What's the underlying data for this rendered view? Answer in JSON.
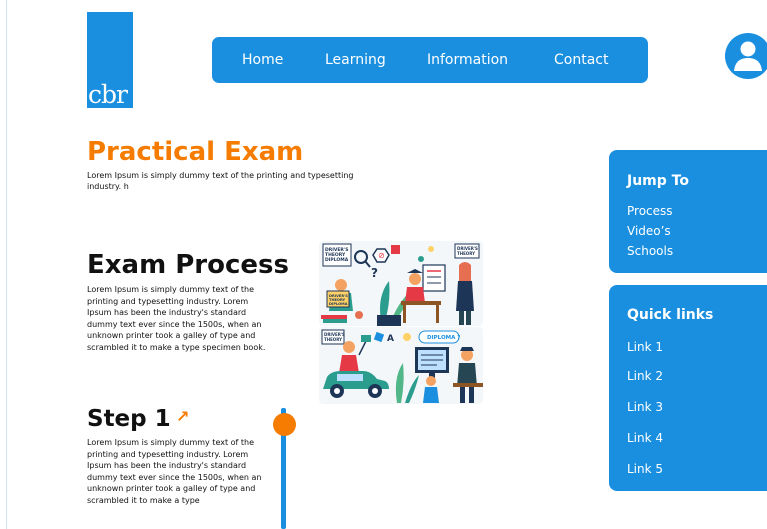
{
  "logo": {
    "text": "cbr"
  },
  "nav": {
    "items": [
      {
        "label": "Home"
      },
      {
        "label": "Learning"
      },
      {
        "label": "Information"
      },
      {
        "label": "Contact"
      }
    ]
  },
  "avatar": {
    "icon": "user-icon"
  },
  "page": {
    "title": "Practical Exam",
    "intro": "Lorem Ipsum is simply dummy text of the printing and typesetting industry. h"
  },
  "exam_process": {
    "heading": "Exam Process",
    "body": "Lorem Ipsum is simply dummy text of the printing and typesetting industry. Lorem Ipsum has been the industry's standard dummy text ever since the 1500s, when an unknown printer took a galley of type and scrambled it to make a type specimen book."
  },
  "step1": {
    "heading": "Step 1",
    "arrow": "↗",
    "body": "Lorem Ipsum is simply dummy text of the printing and typesetting industry. Lorem Ipsum has been the industry's standard dummy text ever since the 1500s, when an unknown printer took a galley of type and scrambled it to make a type"
  },
  "illustrations": {
    "top": {
      "sign_left": "DRIVER'S THEORY DIPLOMA",
      "sign_right": "DRIVER'S THEORY",
      "book_label": "DRIVER'S THEORY DIPLOMA"
    },
    "bottom": {
      "sign_left": "DRIVER'S THEORY",
      "diploma_label": "DIPLOMA"
    }
  },
  "jump_to": {
    "title": "Jump To",
    "links": [
      {
        "label": "Process"
      },
      {
        "label": "Video’s"
      },
      {
        "label": "Schools"
      }
    ]
  },
  "quick_links": {
    "title": "Quick links",
    "links": [
      {
        "label": "Link 1"
      },
      {
        "label": "Link 2"
      },
      {
        "label": "Link 3"
      },
      {
        "label": "Link 4"
      },
      {
        "label": "Link 5"
      }
    ]
  },
  "colors": {
    "primary_blue": "#1a8fe0",
    "accent_orange": "#f57c00",
    "text": "#111111"
  }
}
